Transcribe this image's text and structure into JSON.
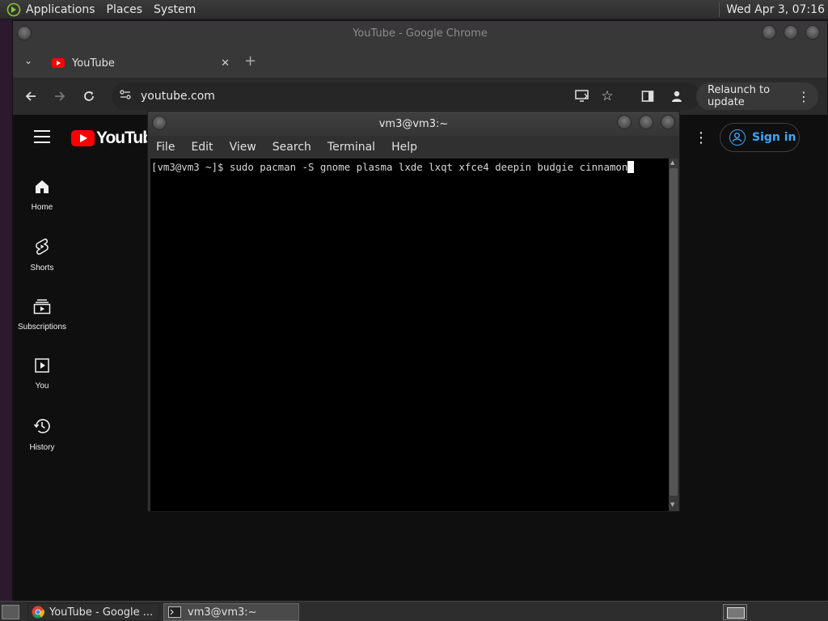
{
  "top_panel": {
    "menus": [
      "Applications",
      "Places",
      "System"
    ],
    "clock": "Wed Apr  3, 07:16"
  },
  "chrome": {
    "window_title": "YouTube - Google Chrome",
    "tab_title": "YouTube",
    "url": "youtube.com",
    "relaunch_label": "Relaunch to update"
  },
  "youtube": {
    "logo_text": "YouTube",
    "sign_in_label": "Sign in",
    "nav": [
      {
        "label": "Home",
        "icon": "home-icon"
      },
      {
        "label": "Shorts",
        "icon": "shorts-icon"
      },
      {
        "label": "Subscriptions",
        "icon": "subscriptions-icon"
      },
      {
        "label": "You",
        "icon": "you-icon"
      },
      {
        "label": "History",
        "icon": "history-icon"
      }
    ]
  },
  "terminal": {
    "window_title": "vm3@vm3:~",
    "menus": [
      "File",
      "Edit",
      "View",
      "Search",
      "Terminal",
      "Help"
    ],
    "prompt": "[vm3@vm3 ~]$ ",
    "command": "sudo pacman -S gnome plasma lxde lxqt xfce4 deepin budgie cinnamon"
  },
  "taskbar": {
    "tasks": [
      "YouTube - Google ...",
      "vm3@vm3:~"
    ]
  },
  "colors": {
    "youtube_red": "#ff0000",
    "signin_blue": "#3ea6ff",
    "terminal_bg": "#000000"
  }
}
